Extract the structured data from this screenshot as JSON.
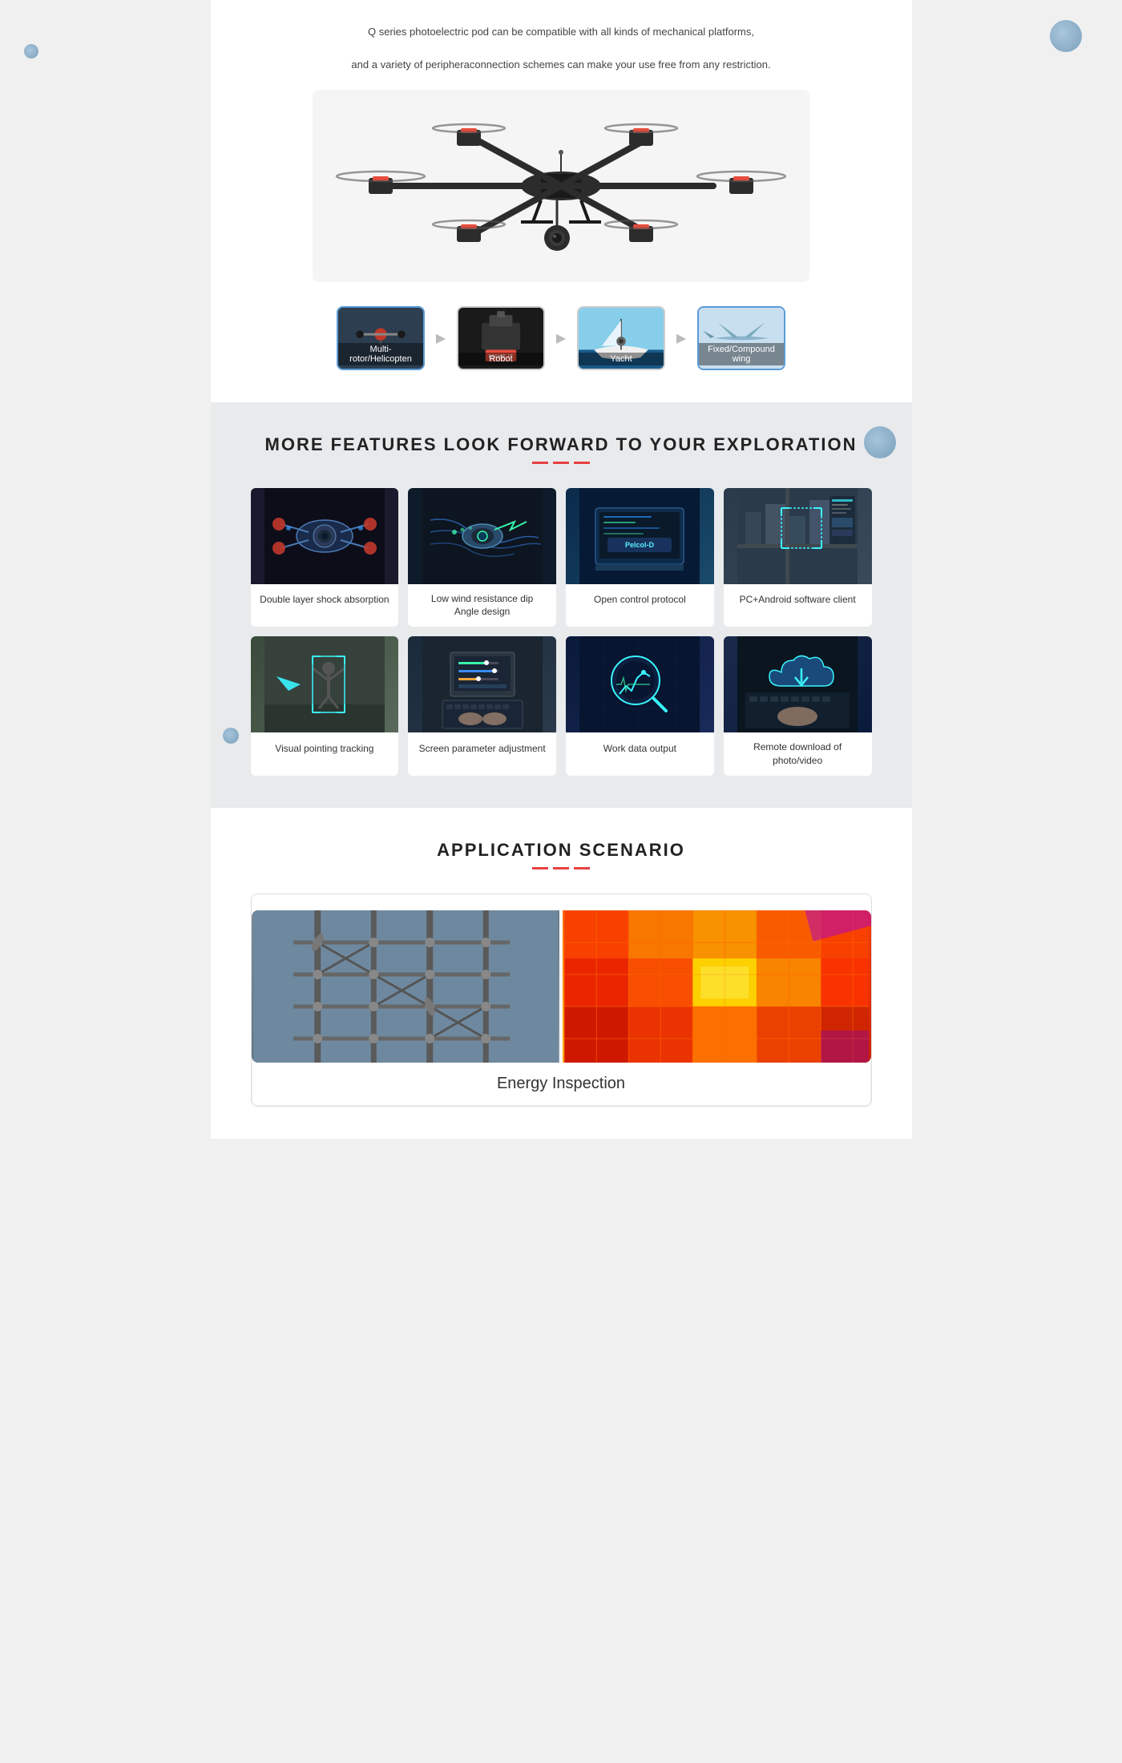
{
  "hero": {
    "description_line1": "Q series photoelectric pod can be compatible with all kinds of mechanical platforms,",
    "description_line2": "and a variety of peripheraconnection schemes can make your use free from any restriction."
  },
  "platforms": [
    {
      "label": "Multi-rotor/Helicopten",
      "active": true,
      "color1": "#c0392b",
      "color2": "#2c3e50"
    },
    {
      "label": "Robot",
      "active": false,
      "color1": "#e74c3c",
      "color2": "#1a1a1a"
    },
    {
      "label": "Yacht",
      "active": false,
      "color1": "#2980b9",
      "color2": "#1a3a5a"
    },
    {
      "label": "Fixed/Compound wing",
      "active": true,
      "color1": "#3498db",
      "color2": "#d0e8f0"
    }
  ],
  "features_section": {
    "title": "MORE FEATURES LOOK FORWARD TO YOUR EXPLORATION",
    "features": [
      {
        "label": "Double layer shock absorption",
        "icon_type": "shock"
      },
      {
        "label": "Low wind resistance dip\nAngle design",
        "icon_type": "wind"
      },
      {
        "label": "Open control protocol",
        "icon_type": "protocol"
      },
      {
        "label": "PC+Android software client",
        "icon_type": "software"
      },
      {
        "label": "Visual pointing tracking",
        "icon_type": "tracking"
      },
      {
        "label": "Screen parameter adjustment",
        "icon_type": "screen"
      },
      {
        "label": "Work data output",
        "icon_type": "data"
      },
      {
        "label": "Remote download of\nphoto/video",
        "icon_type": "download"
      }
    ]
  },
  "application_section": {
    "title": "APPLICATION SCENARIO",
    "energy_label": "Energy Inspection"
  }
}
